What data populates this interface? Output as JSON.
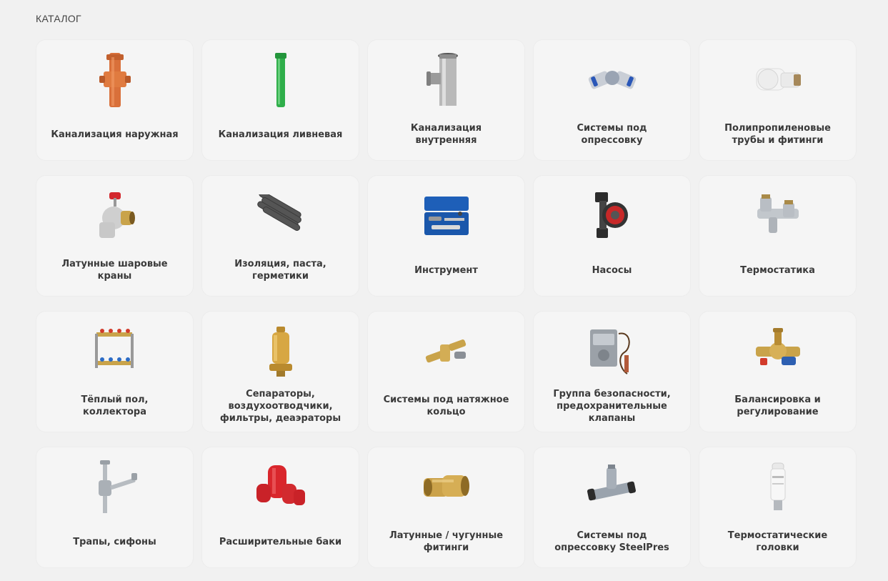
{
  "page": {
    "title": "КАТАЛОГ"
  },
  "catalog": {
    "items": [
      {
        "lines": [
          "Канализация наружная"
        ],
        "icon": "orange-sewer-pipe-icon"
      },
      {
        "lines": [
          "Канализация ливневая"
        ],
        "icon": "green-storm-pipe-icon"
      },
      {
        "lines": [
          "Канализация",
          "внутренняя"
        ],
        "icon": "grey-tee-pipe-icon"
      },
      {
        "lines": [
          "Системы под",
          "опрессовку"
        ],
        "icon": "press-elbow-fitting-icon"
      },
      {
        "lines": [
          "Полипропиленовые",
          "трубы и фитинги"
        ],
        "icon": "white-pp-fitting-icon"
      },
      {
        "lines": [
          "Латунные шаровые",
          "краны"
        ],
        "icon": "brass-ball-valve-icon"
      },
      {
        "lines": [
          "Изоляция, паста,",
          "герметики"
        ],
        "icon": "insulation-tubes-icon"
      },
      {
        "lines": [
          "Инструмент"
        ],
        "icon": "tool-case-icon"
      },
      {
        "lines": [
          "Насосы"
        ],
        "icon": "circulation-pump-icon"
      },
      {
        "lines": [
          "Термостатика"
        ],
        "icon": "thermostatic-valves-icon"
      },
      {
        "lines": [
          "Тёплый пол,",
          "коллектора"
        ],
        "icon": "floor-manifold-icon"
      },
      {
        "lines": [
          "Сепараторы,",
          "воздухоотводчики,",
          "фильтры, деаэраторы"
        ],
        "icon": "brass-separator-icon"
      },
      {
        "lines": [
          "Системы под натяжное",
          "кольцо"
        ],
        "icon": "brass-compression-fittings-icon"
      },
      {
        "lines": [
          "Группа безопасности,",
          "предохранительные",
          "клапаны"
        ],
        "icon": "safety-thermostat-icon"
      },
      {
        "lines": [
          "Балансировка и",
          "регулирование"
        ],
        "icon": "balancing-valve-icon"
      },
      {
        "lines": [
          "Трапы, сифоны"
        ],
        "icon": "chrome-siphon-icon"
      },
      {
        "lines": [
          "Расширительные баки"
        ],
        "icon": "red-expansion-tanks-icon"
      },
      {
        "lines": [
          "Латунные / чугунные",
          "фитинги"
        ],
        "icon": "brass-elbow-icon"
      },
      {
        "lines": [
          "Системы под",
          "опрессовку SteelPres"
        ],
        "icon": "steel-press-tee-icon"
      },
      {
        "lines": [
          "Термостатические",
          "головки"
        ],
        "icon": "thermostatic-head-icon"
      }
    ]
  }
}
